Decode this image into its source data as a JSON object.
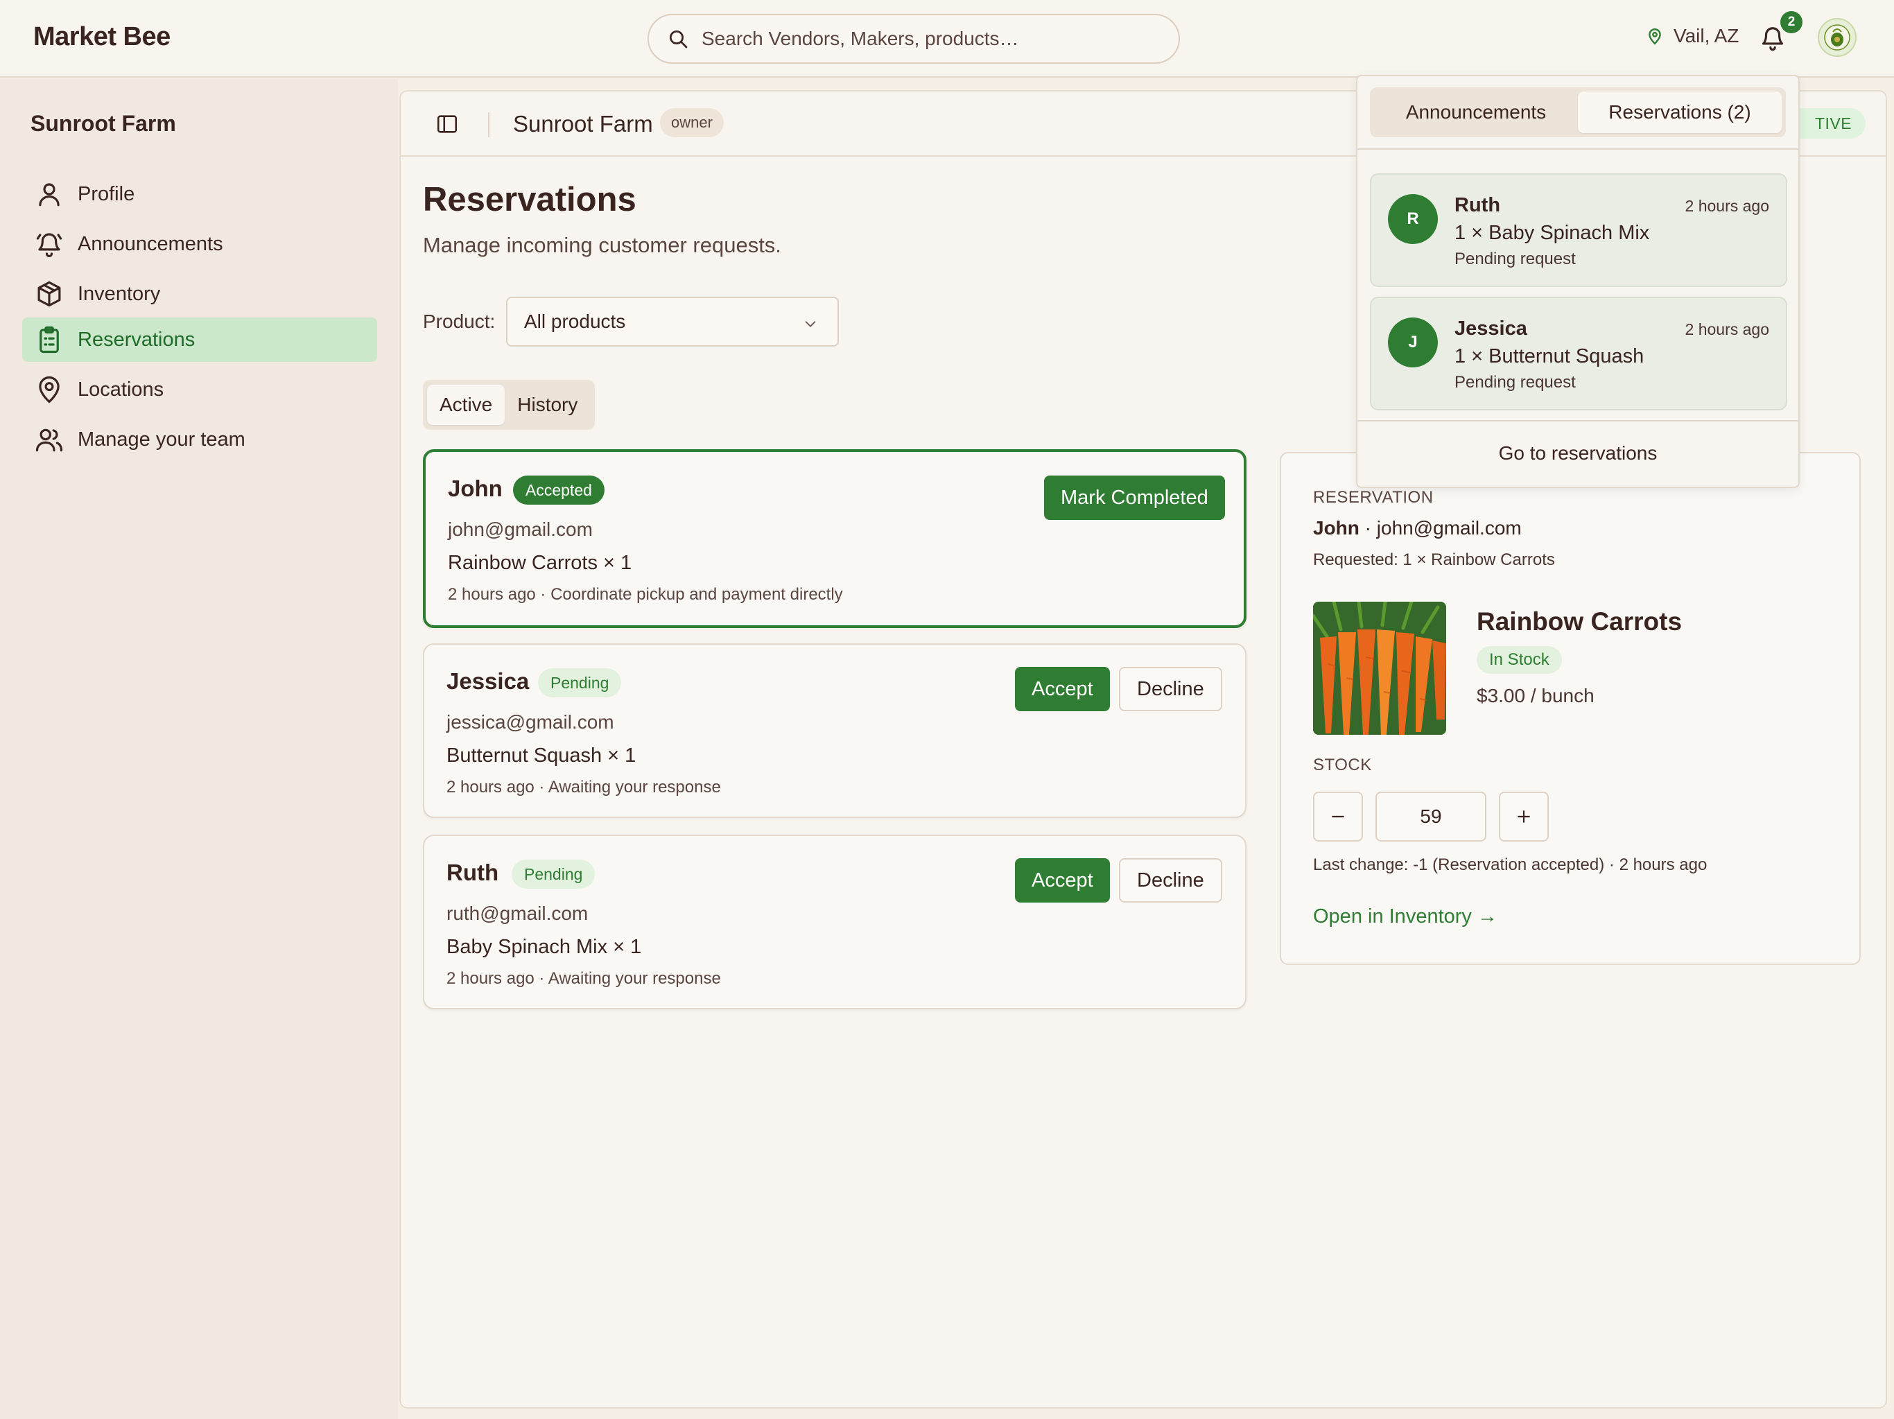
{
  "app": {
    "brand": "Market Bee"
  },
  "topbar": {
    "search_placeholder": "Search Vendors, Makers, products…",
    "location": "Vail, AZ",
    "notification_count": "2"
  },
  "sidebar": {
    "title": "Sunroot Farm",
    "items": [
      {
        "label": "Profile",
        "icon": "person-icon"
      },
      {
        "label": "Announcements",
        "icon": "bell-ring-icon"
      },
      {
        "label": "Inventory",
        "icon": "box-icon"
      },
      {
        "label": "Reservations",
        "icon": "clipboard-icon",
        "active": true
      },
      {
        "label": "Locations",
        "icon": "map-pin-icon"
      },
      {
        "label": "Manage your team",
        "icon": "users-icon"
      }
    ]
  },
  "header": {
    "title": "Sunroot Farm",
    "role_badge": "owner",
    "status_badge": "TIVE"
  },
  "page": {
    "title": "Reservations",
    "subtitle": "Manage incoming customer requests.",
    "product_label": "Product:",
    "product_selected": "All products",
    "tabs": [
      {
        "label": "Active",
        "selected": true
      },
      {
        "label": "History",
        "selected": false
      }
    ]
  },
  "reservations": [
    {
      "name": "John",
      "status": "Accepted",
      "email": "john@gmail.com",
      "item": "Rainbow Carrots × 1",
      "meta": "2 hours ago · Coordinate pickup and payment directly",
      "action": "Mark Completed"
    },
    {
      "name": "Jessica",
      "status": "Pending",
      "email": "jessica@gmail.com",
      "item": "Butternut Squash × 1",
      "meta": "2 hours ago · Awaiting your response",
      "accept": "Accept",
      "decline": "Decline"
    },
    {
      "name": "Ruth",
      "status": "Pending",
      "email": "ruth@gmail.com",
      "item": "Baby Spinach Mix × 1",
      "meta": "2 hours ago · Awaiting your response",
      "accept": "Accept",
      "decline": "Decline"
    }
  ],
  "detail": {
    "section_label": "RESERVATION",
    "customer_name": "John",
    "customer_email": "· john@gmail.com",
    "requested": "Requested: 1 × Rainbow Carrots",
    "product_name": "Rainbow Carrots",
    "stock_badge": "In Stock",
    "price": "$3.00 / bunch",
    "stock_label": "STOCK",
    "stock_value": "59",
    "last_change": "Last change: -1 (Reservation accepted) · 2 hours ago",
    "open_link": "Open in Inventory →"
  },
  "notifications": {
    "tabs": [
      {
        "label": "Announcements",
        "selected": false
      },
      {
        "label": "Reservations (2)",
        "selected": true
      }
    ],
    "items": [
      {
        "initial": "R",
        "name": "Ruth",
        "time": "2 hours ago",
        "item": "1 × Baby Spinach Mix",
        "status": "Pending request"
      },
      {
        "initial": "J",
        "name": "Jessica",
        "time": "2 hours ago",
        "item": "1 × Butternut Squash",
        "status": "Pending request"
      }
    ],
    "footer": "Go to reservations"
  },
  "colors": {
    "accent_green": "#2e7d32",
    "active_nav_bg": "#cbe8cc",
    "page_bg": "#f5efe6",
    "text_dark": "#3a2420"
  }
}
